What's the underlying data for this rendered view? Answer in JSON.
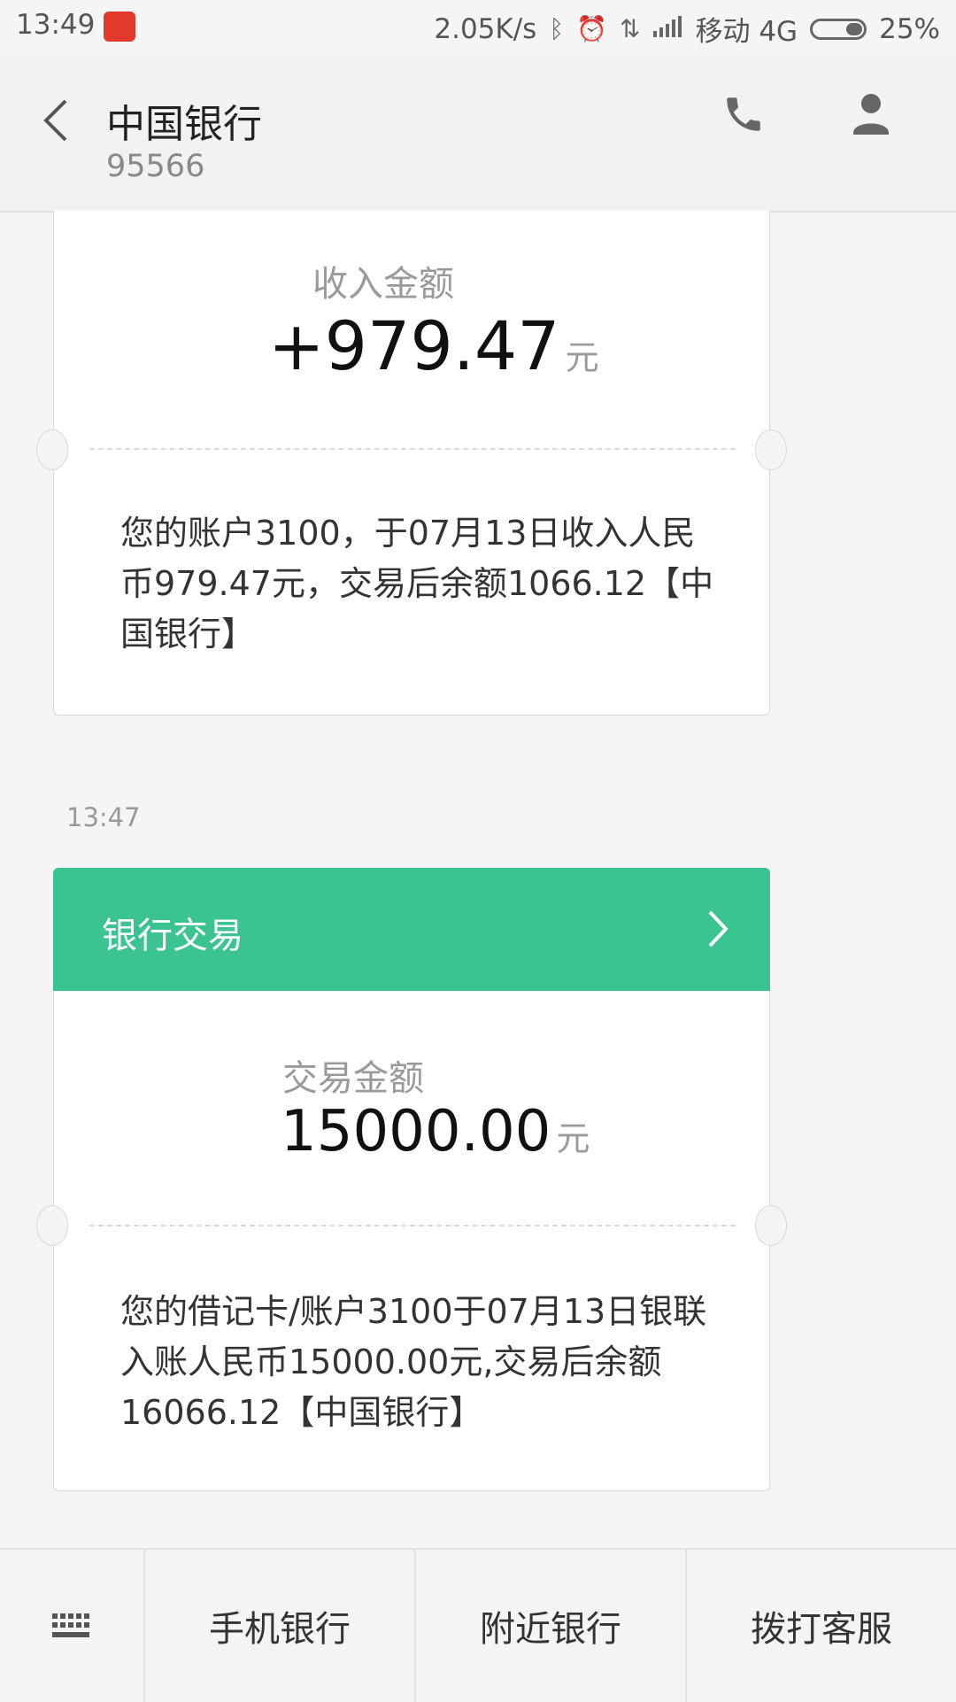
{
  "status_bar": {
    "time": "13:49",
    "speed": "2.05K/s",
    "carrier": "移动 4G",
    "battery": "25%",
    "icons": [
      "bluetooth-icon",
      "alarm-icon",
      "data-arrows-icon",
      "signal-icon",
      "battery-icon"
    ]
  },
  "header": {
    "title": "中国银行",
    "number": "95566",
    "icons": [
      "back-arrow-icon",
      "phone-icon",
      "contact-icon"
    ]
  },
  "messages": [
    {
      "amount_label": "收入金额",
      "amount": "+979.47",
      "unit": "元",
      "body": "您的账户3100，于07月13日收入人民币979.47元，交易后余额1066.12【中国银行】"
    },
    {
      "timestamp": "13:47",
      "category": "银行交易",
      "amount_label": "交易金额",
      "amount": "15000.00",
      "unit": "元",
      "body": "您的借记卡/账户3100于07月13日银联入账人民币15000.00元,交易后余额16066.12【中国银行】"
    }
  ],
  "bottom_bar": {
    "items": [
      "手机银行",
      "附近银行",
      "拨打客服"
    ],
    "keyboard_icon": "keyboard-icon"
  },
  "colors": {
    "accent_green": "#3bc492",
    "background": "#f5f5f5"
  }
}
